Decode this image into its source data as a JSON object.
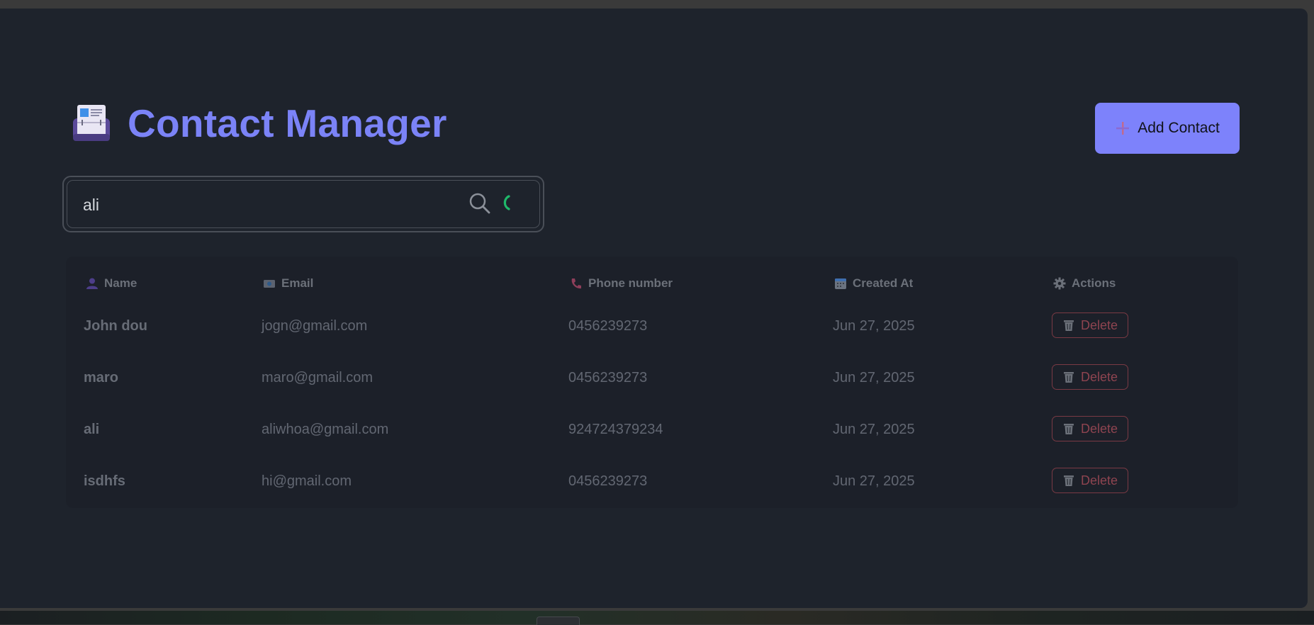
{
  "header": {
    "title": "Contact Manager",
    "logo_icon": "rolodex-icon"
  },
  "toolbar": {
    "add_label": "Add Contact",
    "add_icon": "plus-icon"
  },
  "search": {
    "value": "ali",
    "icon": "search-icon",
    "spinner_icon": "loading-spinner-icon"
  },
  "table": {
    "columns": [
      {
        "label": "Name",
        "icon": "person-icon"
      },
      {
        "label": "Email",
        "icon": "email-icon"
      },
      {
        "label": "Phone number",
        "icon": "phone-icon"
      },
      {
        "label": "Created At",
        "icon": "calendar-icon"
      },
      {
        "label": "Actions",
        "icon": "gear-icon"
      }
    ],
    "rows": [
      {
        "name": "John dou",
        "email": "jogn@gmail.com",
        "phone": "0456239273",
        "created": "Jun 27, 2025",
        "action": "Delete"
      },
      {
        "name": "maro",
        "email": "maro@gmail.com",
        "phone": "0456239273",
        "created": "Jun 27, 2025",
        "action": "Delete"
      },
      {
        "name": "ali",
        "email": "aliwhoa@gmail.com",
        "phone": "924724379234",
        "created": "Jun 27, 2025",
        "action": "Delete"
      },
      {
        "name": "isdhfs",
        "email": "hi@gmail.com",
        "phone": "0456239273",
        "created": "Jun 27, 2025",
        "action": "Delete"
      }
    ]
  },
  "colors": {
    "background": "#1e232c",
    "accent": "#7d82fb",
    "title": "#7b83f7",
    "danger": "#8e4450",
    "spinner": "#1fb86a"
  }
}
